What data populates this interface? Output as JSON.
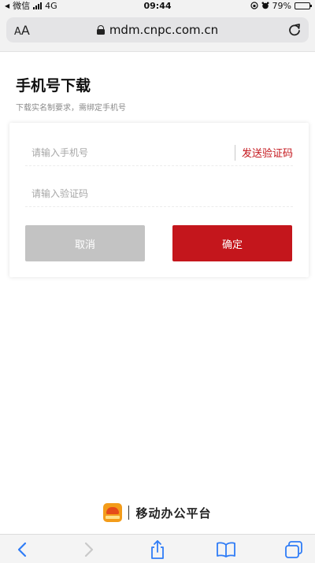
{
  "status_bar": {
    "carrier": "微信",
    "network": "4G",
    "time": "09:44",
    "battery": "79%",
    "battery_level": 0.79
  },
  "browser": {
    "text_size_small": "A",
    "text_size_big": "A",
    "url": "mdm.cnpc.com.cn"
  },
  "page": {
    "title": "手机号下载",
    "subtitle": "下载实名制要求，需绑定手机号"
  },
  "form": {
    "phone_placeholder": "请输入手机号",
    "phone_value": "",
    "code_placeholder": "请输入验证码",
    "code_value": "",
    "send_code_label": "发送验证码",
    "cancel_label": "取消",
    "confirm_label": "确定"
  },
  "brand": {
    "name": "移动办公平台"
  },
  "colors": {
    "accent": "#c4161c",
    "cancel_gray": "#c3c3c3",
    "ios_blue": "#2f7cf6"
  },
  "icons": {
    "status": [
      "back-arrow-icon",
      "signal-icon",
      "lock-rotation-icon",
      "alarm-icon",
      "battery-icon"
    ],
    "url_bar": [
      "lock-icon",
      "reload-icon"
    ],
    "toolbar": [
      "back-icon",
      "forward-icon",
      "share-icon",
      "bookmarks-icon",
      "tabs-icon"
    ]
  }
}
